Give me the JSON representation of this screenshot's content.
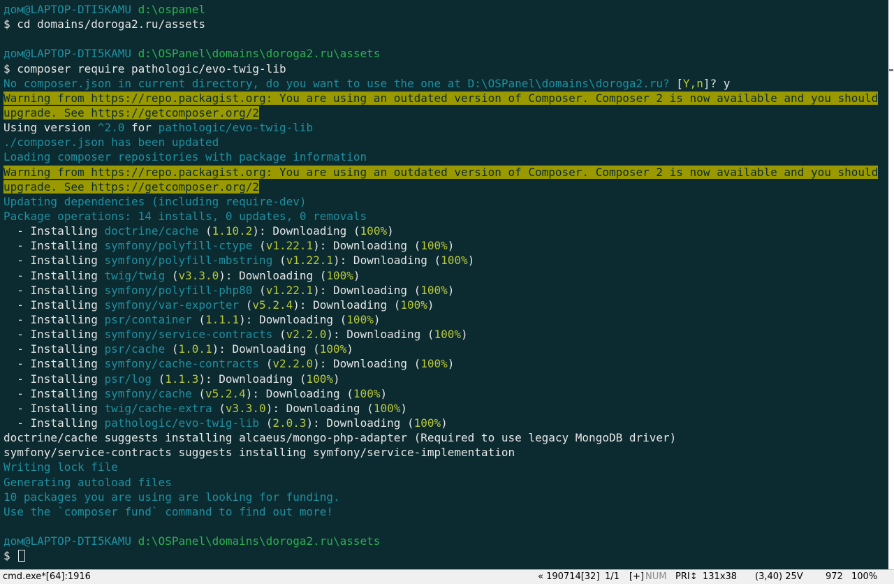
{
  "palette": {
    "default": "#e6e6e6",
    "green": "#2bb24c",
    "cyan": "#1f8fa0",
    "path": "#b9c83a",
    "warn_bg": "#9a9a00",
    "warn_fg": "#0c2b30",
    "background": "#0c2b30"
  },
  "terminal": {
    "lines": [
      [
        {
          "t": "дом@LAPTOP-DTI5KAMU ",
          "c": "cyan"
        },
        {
          "t": "d:\\ospanel",
          "c": "green"
        }
      ],
      [
        {
          "t": "$ cd domains/doroga2.ru/assets",
          "c": "default"
        }
      ],
      [],
      [
        {
          "t": "дом@LAPTOP-DTI5KAMU ",
          "c": "cyan"
        },
        {
          "t": "d:\\OSPanel\\domains\\doroga2.ru\\assets",
          "c": "green"
        }
      ],
      [
        {
          "t": "$ composer require pathologic/evo-twig-lib",
          "c": "default"
        }
      ],
      [
        {
          "t": "No composer.json in current directory, do you want to use the one at D:\\OSPanel\\domains\\doroga2.ru? ",
          "c": "cyan"
        },
        {
          "t": "[",
          "c": "default"
        },
        {
          "t": "Y,n",
          "c": "path"
        },
        {
          "t": "]? y",
          "c": "default"
        }
      ],
      [
        {
          "t": "Warning from https://repo.packagist.org: You are using an outdated version of Composer. Composer 2 is now available and you should",
          "c": "warn"
        }
      ],
      [
        {
          "t": "upgrade. See https://getcomposer.org/2",
          "c": "warn"
        }
      ],
      [
        {
          "t": "Using version ",
          "c": "default"
        },
        {
          "t": "^2.0",
          "c": "cyan"
        },
        {
          "t": " for ",
          "c": "default"
        },
        {
          "t": "pathologic/evo-twig-lib",
          "c": "cyan"
        }
      ],
      [
        {
          "t": "./composer.json has been updated",
          "c": "cyan"
        }
      ],
      [
        {
          "t": "Loading composer repositories with package information",
          "c": "cyan"
        }
      ],
      [
        {
          "t": "Warning from https://repo.packagist.org: You are using an outdated version of Composer. Composer 2 is now available and you should",
          "c": "warn"
        }
      ],
      [
        {
          "t": "upgrade. See https://getcomposer.org/2",
          "c": "warn"
        }
      ],
      [
        {
          "t": "Updating dependencies (including require-dev)",
          "c": "cyan"
        }
      ],
      [
        {
          "t": "Package operations: 14 installs, 0 updates, 0 removals",
          "c": "cyan"
        }
      ],
      [
        {
          "t": "  - Installing ",
          "c": "default"
        },
        {
          "t": "doctrine/cache",
          "c": "cyan"
        },
        {
          "t": " (",
          "c": "default"
        },
        {
          "t": "1.10.2",
          "c": "path"
        },
        {
          "t": "): Downloading (",
          "c": "default"
        },
        {
          "t": "100%",
          "c": "path"
        },
        {
          "t": ")",
          "c": "default"
        }
      ],
      [
        {
          "t": "  - Installing ",
          "c": "default"
        },
        {
          "t": "symfony/polyfill-ctype",
          "c": "cyan"
        },
        {
          "t": " (",
          "c": "default"
        },
        {
          "t": "v1.22.1",
          "c": "path"
        },
        {
          "t": "): Downloading (",
          "c": "default"
        },
        {
          "t": "100%",
          "c": "path"
        },
        {
          "t": ")",
          "c": "default"
        }
      ],
      [
        {
          "t": "  - Installing ",
          "c": "default"
        },
        {
          "t": "symfony/polyfill-mbstring",
          "c": "cyan"
        },
        {
          "t": " (",
          "c": "default"
        },
        {
          "t": "v1.22.1",
          "c": "path"
        },
        {
          "t": "): Downloading (",
          "c": "default"
        },
        {
          "t": "100%",
          "c": "path"
        },
        {
          "t": ")",
          "c": "default"
        }
      ],
      [
        {
          "t": "  - Installing ",
          "c": "default"
        },
        {
          "t": "twig/twig",
          "c": "cyan"
        },
        {
          "t": " (",
          "c": "default"
        },
        {
          "t": "v3.3.0",
          "c": "path"
        },
        {
          "t": "): Downloading (",
          "c": "default"
        },
        {
          "t": "100%",
          "c": "path"
        },
        {
          "t": ")",
          "c": "default"
        }
      ],
      [
        {
          "t": "  - Installing ",
          "c": "default"
        },
        {
          "t": "symfony/polyfill-php80",
          "c": "cyan"
        },
        {
          "t": " (",
          "c": "default"
        },
        {
          "t": "v1.22.1",
          "c": "path"
        },
        {
          "t": "): Downloading (",
          "c": "default"
        },
        {
          "t": "100%",
          "c": "path"
        },
        {
          "t": ")",
          "c": "default"
        }
      ],
      [
        {
          "t": "  - Installing ",
          "c": "default"
        },
        {
          "t": "symfony/var-exporter",
          "c": "cyan"
        },
        {
          "t": " (",
          "c": "default"
        },
        {
          "t": "v5.2.4",
          "c": "path"
        },
        {
          "t": "): Downloading (",
          "c": "default"
        },
        {
          "t": "100%",
          "c": "path"
        },
        {
          "t": ")",
          "c": "default"
        }
      ],
      [
        {
          "t": "  - Installing ",
          "c": "default"
        },
        {
          "t": "psr/container",
          "c": "cyan"
        },
        {
          "t": " (",
          "c": "default"
        },
        {
          "t": "1.1.1",
          "c": "path"
        },
        {
          "t": "): Downloading (",
          "c": "default"
        },
        {
          "t": "100%",
          "c": "path"
        },
        {
          "t": ")",
          "c": "default"
        }
      ],
      [
        {
          "t": "  - Installing ",
          "c": "default"
        },
        {
          "t": "symfony/service-contracts",
          "c": "cyan"
        },
        {
          "t": " (",
          "c": "default"
        },
        {
          "t": "v2.2.0",
          "c": "path"
        },
        {
          "t": "): Downloading (",
          "c": "default"
        },
        {
          "t": "100%",
          "c": "path"
        },
        {
          "t": ")",
          "c": "default"
        }
      ],
      [
        {
          "t": "  - Installing ",
          "c": "default"
        },
        {
          "t": "psr/cache",
          "c": "cyan"
        },
        {
          "t": " (",
          "c": "default"
        },
        {
          "t": "1.0.1",
          "c": "path"
        },
        {
          "t": "): Downloading (",
          "c": "default"
        },
        {
          "t": "100%",
          "c": "path"
        },
        {
          "t": ")",
          "c": "default"
        }
      ],
      [
        {
          "t": "  - Installing ",
          "c": "default"
        },
        {
          "t": "symfony/cache-contracts",
          "c": "cyan"
        },
        {
          "t": " (",
          "c": "default"
        },
        {
          "t": "v2.2.0",
          "c": "path"
        },
        {
          "t": "): Downloading (",
          "c": "default"
        },
        {
          "t": "100%",
          "c": "path"
        },
        {
          "t": ")",
          "c": "default"
        }
      ],
      [
        {
          "t": "  - Installing ",
          "c": "default"
        },
        {
          "t": "psr/log",
          "c": "cyan"
        },
        {
          "t": " (",
          "c": "default"
        },
        {
          "t": "1.1.3",
          "c": "path"
        },
        {
          "t": "): Downloading (",
          "c": "default"
        },
        {
          "t": "100%",
          "c": "path"
        },
        {
          "t": ")",
          "c": "default"
        }
      ],
      [
        {
          "t": "  - Installing ",
          "c": "default"
        },
        {
          "t": "symfony/cache",
          "c": "cyan"
        },
        {
          "t": " (",
          "c": "default"
        },
        {
          "t": "v5.2.4",
          "c": "path"
        },
        {
          "t": "): Downloading (",
          "c": "default"
        },
        {
          "t": "100%",
          "c": "path"
        },
        {
          "t": ")",
          "c": "default"
        }
      ],
      [
        {
          "t": "  - Installing ",
          "c": "default"
        },
        {
          "t": "twig/cache-extra",
          "c": "cyan"
        },
        {
          "t": " (",
          "c": "default"
        },
        {
          "t": "v3.3.0",
          "c": "path"
        },
        {
          "t": "): Downloading (",
          "c": "default"
        },
        {
          "t": "100%",
          "c": "path"
        },
        {
          "t": ")",
          "c": "default"
        }
      ],
      [
        {
          "t": "  - Installing ",
          "c": "default"
        },
        {
          "t": "pathologic/evo-twig-lib",
          "c": "cyan"
        },
        {
          "t": " (",
          "c": "default"
        },
        {
          "t": "2.0.3",
          "c": "path"
        },
        {
          "t": "): Downloading (",
          "c": "default"
        },
        {
          "t": "100%",
          "c": "path"
        },
        {
          "t": ")",
          "c": "default"
        }
      ],
      [
        {
          "t": "doctrine/cache suggests installing alcaeus/mongo-php-adapter (Required to use legacy MongoDB driver)",
          "c": "default"
        }
      ],
      [
        {
          "t": "symfony/service-contracts suggests installing symfony/service-implementation",
          "c": "default"
        }
      ],
      [
        {
          "t": "Writing lock file",
          "c": "cyan"
        }
      ],
      [
        {
          "t": "Generating autoload files",
          "c": "cyan"
        }
      ],
      [
        {
          "t": "10 packages you are using are looking for funding.",
          "c": "cyan"
        }
      ],
      [
        {
          "t": "Use the `composer fund` command to find out more!",
          "c": "cyan"
        }
      ],
      [],
      [
        {
          "t": "дом@LAPTOP-DTI5KAMU ",
          "c": "cyan"
        },
        {
          "t": "d:\\OSPanel\\domains\\doroga2.ru\\assets",
          "c": "green"
        }
      ],
      [
        {
          "t": "$ ",
          "c": "default"
        }
      ]
    ]
  },
  "statusbar": {
    "process": "cmd.exe*[64]:1916",
    "build": "« 190714[32]",
    "tabs": "1/1",
    "plus": "[+]",
    "num": "NUM",
    "pri": "PRI↕",
    "size": "131x38",
    "cursor_pos": "(3,40) 25V",
    "pid": "972",
    "zoom": "100%"
  }
}
